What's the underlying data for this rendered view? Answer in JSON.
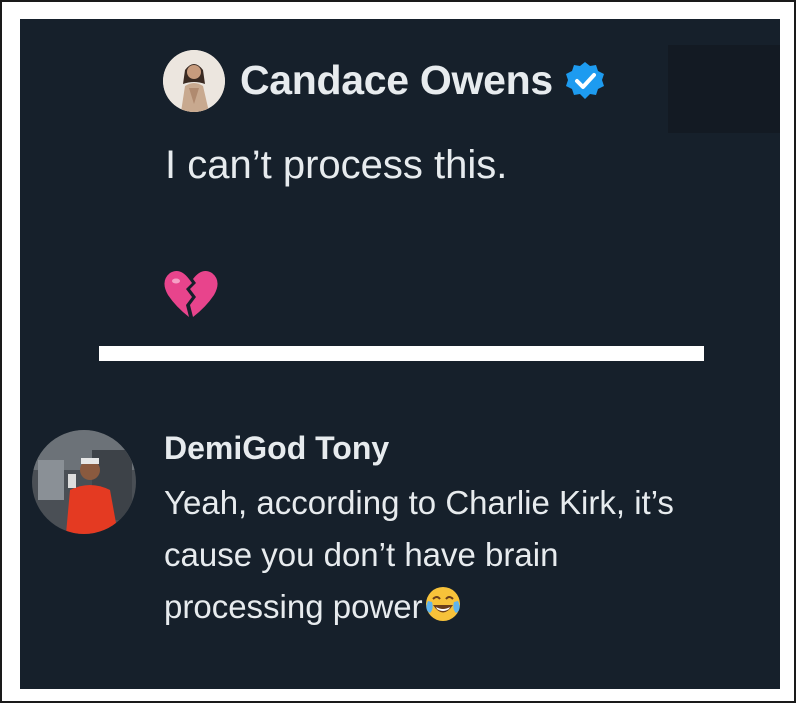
{
  "post": {
    "author_name": "Candace Owens",
    "verified": true,
    "text": "I can’t process this.",
    "emoji": "broken-heart"
  },
  "reply": {
    "author_name": "DemiGod Tony",
    "lines": [
      "Yeah, according to Charlie Kirk, it’s",
      "cause you don’t have brain",
      "processing power"
    ],
    "trailing_emoji": "face-with-tears-of-joy"
  },
  "colors": {
    "background": "#16202b",
    "text": "#e7ebee",
    "verified_badge": "#1d9bf0",
    "frame": "#ffffff"
  }
}
